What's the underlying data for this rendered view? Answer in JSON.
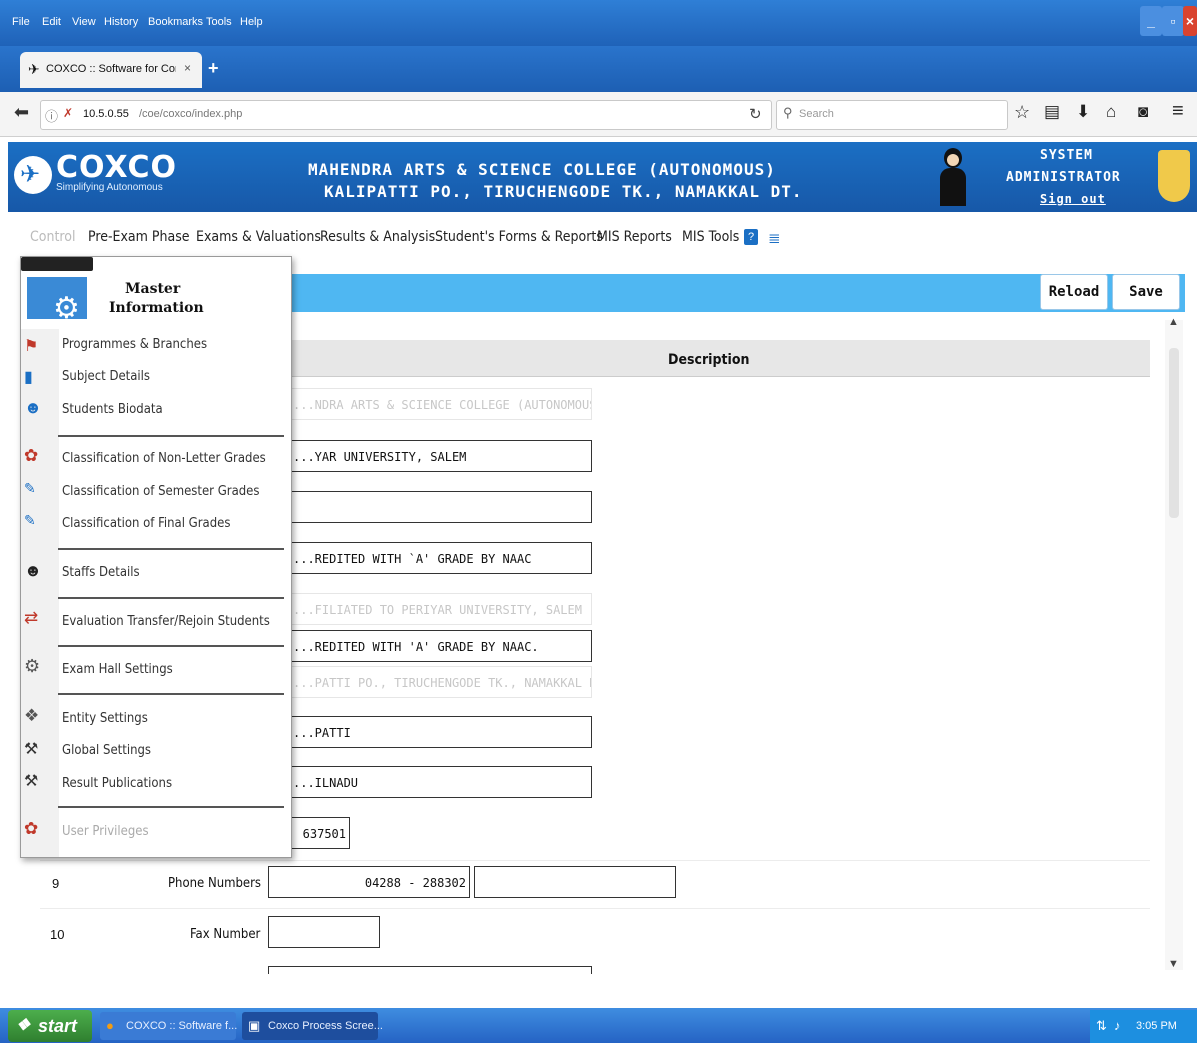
{
  "browser": {
    "menu": [
      "File",
      "Edit",
      "View",
      "History",
      "Bookmarks",
      "Tools",
      "Help"
    ],
    "tab_title": "COXCO :: Software for Contr...",
    "url_host": "10.5.0.55",
    "url_path": "/coe/coxco/index.php",
    "search_placeholder": "Search"
  },
  "header": {
    "logo_text": "COXCO",
    "logo_tagline": "Simplifying Autonomous",
    "college_line1": "MAHENDRA ARTS & SCIENCE COLLEGE (AUTONOMOUS)",
    "college_line2": "KALIPATTI PO., TIRUCHENGODE TK., NAMAKKAL DT.",
    "user_line1": "SYSTEM",
    "user_line2": "ADMINISTRATOR",
    "signout": "Sign out"
  },
  "appmenu": {
    "items": [
      "Control",
      "Pre-Exam Phase",
      "Exams & Valuations",
      "Results & Analysis",
      "Student's Forms & Reports",
      "MIS Reports",
      "MIS Tools"
    ]
  },
  "toolbar": {
    "reload": "Reload",
    "save": "Save"
  },
  "grid": {
    "description_header": "Description"
  },
  "dropdown": {
    "title_line1": "Master",
    "title_line2": "Information",
    "items": [
      "Programmes & Branches",
      "Subject Details",
      "Students Biodata",
      "Classification of Non-Letter Grades",
      "Classification of Semester Grades",
      "Classification of Final Grades",
      "Staffs Details",
      "Evaluation Transfer/Rejoin Students",
      "Exam Hall Settings",
      "Entity Settings",
      "Global Settings",
      "Result Publications",
      "User Privileges"
    ]
  },
  "fields": {
    "f1": "...NDRA ARTS & SCIENCE COLLEGE (AUTONOMOUS)",
    "f2": "...YAR UNIVERSITY, SALEM",
    "f3": "",
    "f4": "...REDITED WITH `A' GRADE BY NAAC",
    "f5": "...FILIATED TO PERIYAR UNIVERSITY, SALEM",
    "f6": "...REDITED WITH 'A' GRADE BY NAAC.",
    "f7": "...PATTI PO., TIRUCHENGODE TK., NAMAKKAL DT.",
    "f8": "...PATTI",
    "f9": "...ILNADU",
    "f10": "637501",
    "phone": "04288 - 288302",
    "phone2": "",
    "fax": ""
  },
  "rows": [
    {
      "no": "9",
      "label": "Phone Numbers"
    },
    {
      "no": "10",
      "label": "Fax Number"
    }
  ],
  "taskbar": {
    "start": "start",
    "item1": "COXCO :: Software f...",
    "item2": "Coxco Process Scree...",
    "clock": "3:05 PM"
  }
}
